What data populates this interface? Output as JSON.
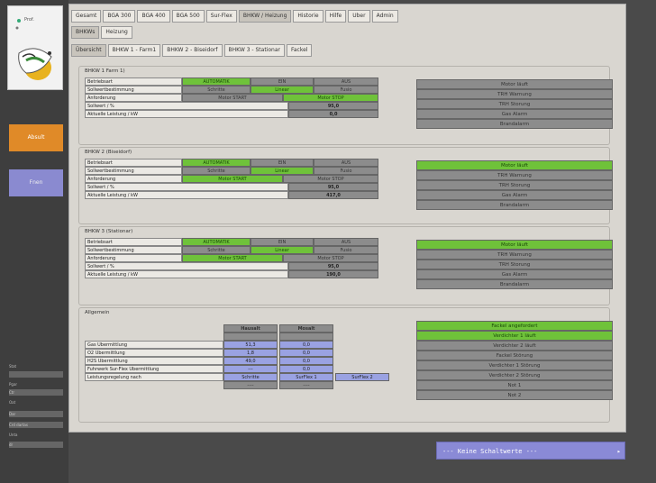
{
  "sidebar": {
    "orange_button": "Absult",
    "blue_button": "Fnen",
    "fields": [
      {
        "label": "Stat",
        "value": ""
      },
      {
        "label": "Pgar",
        "value": ""
      },
      {
        "label": "Ogt",
        "value": "Ctr"
      },
      {
        "label": "Oat",
        "value": ""
      },
      {
        "label": "",
        "value": "Dar"
      },
      {
        "label": "",
        "value": "Crd dartas"
      },
      {
        "label": "Unta",
        "value": ""
      },
      {
        "label": "",
        "value": "dr"
      }
    ]
  },
  "tabs_top": [
    "Gesamt",
    "BGA 300",
    "BGA 400",
    "BGA 500",
    "Sur-Flex",
    "BHKW / Heizung",
    "Historie",
    "Hilfe",
    "Uber",
    "Admin"
  ],
  "tabs_second": [
    "BHKWs",
    "Heizung"
  ],
  "tabs_third": [
    "Übersicht",
    "BHKW 1 - Farm1",
    "BHKW 2 - Biseidorf",
    "BHKW 3 - Stationar",
    "Fackel"
  ],
  "groups": [
    {
      "title": "BHKW 1 Farm 1)",
      "labels": [
        "Betriebsart",
        "Sollwertbestimmung",
        "Anforderung",
        "Sollwert / %",
        "Aktuelle Leistung / kW"
      ],
      "mode": [
        "AUTOMATIK",
        "EIN",
        "AUS"
      ],
      "sw": [
        "Schritte",
        "Linear",
        "Fusio"
      ],
      "anf": [
        "Motor START",
        "Motor STOP"
      ],
      "sollwert": "95,0",
      "leistung": "0,0",
      "status": [
        "Motor läuft",
        "TRH Warnung",
        "TRH Storung",
        "Gas Alarm",
        "Brandalarm"
      ]
    },
    {
      "title": "BHKW 2 (Biseidorf)",
      "labels": [
        "Betriebsart",
        "Sollwertbestimmung",
        "Anforderung",
        "Sollwert / %",
        "Aktuelle Leistung / kW"
      ],
      "mode": [
        "AUTOMATIK",
        "EIN",
        "AUS"
      ],
      "sw": [
        "Schritte",
        "Linear",
        "Fusio"
      ],
      "anf": [
        "Motor START",
        "Motor STOP"
      ],
      "sollwert": "95,0",
      "leistung": "417,0",
      "status": [
        "Motor läuft",
        "TRH Warnung",
        "TRH Storung",
        "Gas Alarm",
        "Brandalarm"
      ]
    },
    {
      "title": "BHKW 3 (Stationar)",
      "labels": [
        "Betriebsart",
        "Sollwertbestimmung",
        "Anforderung",
        "Sollwert / %",
        "Aktuelle Leistung / kW"
      ],
      "mode": [
        "AUTOMATIK",
        "EIN",
        "AUS"
      ],
      "sw": [
        "Schritte",
        "Linear",
        "Fusio"
      ],
      "anf": [
        "Motor START",
        "Motor STOP"
      ],
      "sollwert": "95,0",
      "leistung": "190,0",
      "status": [
        "Motor läuft",
        "TRH Warnung",
        "TRH Storung",
        "Gas Alarm",
        "Brandalarm"
      ]
    }
  ],
  "allgemein": {
    "title": "Allgemein",
    "col_headers": [
      "Hausalt",
      "Mosalt"
    ],
    "rows": [
      {
        "label": "Gas Ubermittlung",
        "a": "51,3",
        "b": "0,0"
      },
      {
        "label": "O2 Ubermittlung",
        "a": "1,8",
        "b": "0,0"
      },
      {
        "label": "H2S Ubermittlung",
        "a": "49,0",
        "b": "0,0"
      },
      {
        "label": "Fuhrwerk Sur-Flex Ubermittlung",
        "a": "---",
        "b": "0,0"
      }
    ],
    "leistung_label": "Leistungsregelung nach",
    "leistung_opts": [
      "Schritte",
      "SurFlex 1",
      "SurFlex 2"
    ],
    "extra_a": "----",
    "extra_b": "----",
    "status": [
      "Fackel angefordert",
      "Verdichter 1 läuft",
      "Verdichter 2 läuft",
      "Fackel Störung",
      "Verdichter 1 Störung",
      "Verdichter 2 Störung",
      "Not 1",
      "Not 2"
    ]
  },
  "status_bar": {
    "text": "--- Keine Schaltwerte ---",
    "arrow": "▸"
  }
}
